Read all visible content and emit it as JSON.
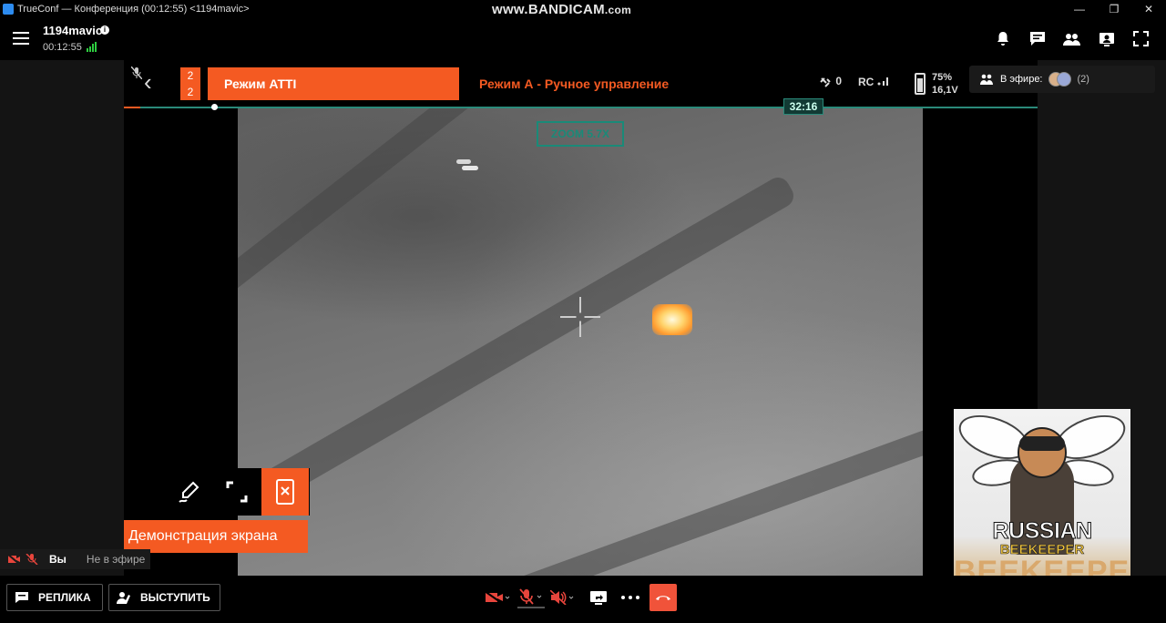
{
  "window": {
    "title": "TrueConf — Конференция (00:12:55) <1194mavic>",
    "watermark_main": "www.BANDICAM",
    "watermark_suffix": ".com",
    "minimize": "—",
    "restore": "❐",
    "close": "✕"
  },
  "header": {
    "conference_name": "1194mavic",
    "info": "i",
    "elapsed": "00:12:55",
    "colors": {
      "signal": "#2ecc40"
    }
  },
  "drone_hud": {
    "counter_top": "2",
    "counter_bottom": "2",
    "flight_mode": "Режим ATTI",
    "control_mode": "Режим А - Ручное управление",
    "satellites": "0",
    "rc_label": "RC",
    "battery_percent": "75%",
    "battery_voltage": "16,1V",
    "flight_time": "32:16",
    "zoom": "ZOOM 5.7X",
    "colors": {
      "accent": "#f45a22",
      "teal": "#1a8a78"
    }
  },
  "on_air": {
    "label": "В эфире:",
    "count": "(2)"
  },
  "screen_share": {
    "label": "Демонстрация экрана"
  },
  "self": {
    "name": "Вы",
    "status": "Не в эфире"
  },
  "participant": {
    "logo_line1": "RUSSIAN",
    "logo_line2": "BEEKEEPER",
    "logo_line3": "BEEKEEPER"
  },
  "toolbar": {
    "replika_label": "РЕПЛИКА",
    "speak_label": "ВЫСТУПИТЬ",
    "colors": {
      "end_call": "#f0533a",
      "muted": "#e8453c"
    }
  }
}
